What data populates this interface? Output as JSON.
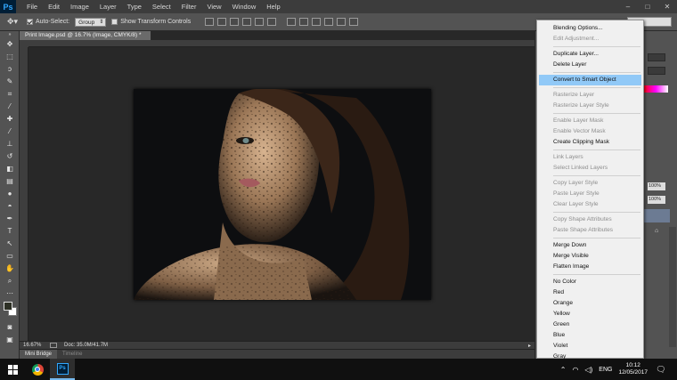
{
  "app": {
    "logo": "Ps"
  },
  "menubar": {
    "items": [
      "File",
      "Edit",
      "Image",
      "Layer",
      "Type",
      "Select",
      "Filter",
      "View",
      "Window",
      "Help"
    ],
    "window_controls": [
      "–",
      "□",
      "✕"
    ]
  },
  "options_bar": {
    "auto_select_label": "Auto-Select:",
    "auto_select_checked": true,
    "auto_select_value": "Group",
    "transform_label": "Show Transform Controls",
    "transform_checked": false
  },
  "document": {
    "tab_title": "Print Image.psd @ 16.7% (Image, CMYK/8) *",
    "zoom": "16.67%",
    "doc_size": "Doc: 35.0M/41.7M"
  },
  "bottom_tabs": [
    "Mini Bridge",
    "Timeline"
  ],
  "right_panel": {
    "opacity_value": "100%",
    "fill_value": "100%"
  },
  "context_menu": {
    "groups": [
      [
        {
          "label": "Blending Options...",
          "enabled": true
        },
        {
          "label": "Edit Adjustment...",
          "enabled": false
        }
      ],
      [
        {
          "label": "Duplicate Layer...",
          "enabled": true
        },
        {
          "label": "Delete Layer",
          "enabled": true
        }
      ],
      [
        {
          "label": "Convert to Smart Object",
          "enabled": true,
          "highlighted": true
        }
      ],
      [
        {
          "label": "Rasterize Layer",
          "enabled": false
        },
        {
          "label": "Rasterize Layer Style",
          "enabled": false
        }
      ],
      [
        {
          "label": "Enable Layer Mask",
          "enabled": false
        },
        {
          "label": "Enable Vector Mask",
          "enabled": false
        },
        {
          "label": "Create Clipping Mask",
          "enabled": true
        }
      ],
      [
        {
          "label": "Link Layers",
          "enabled": false
        },
        {
          "label": "Select Linked Layers",
          "enabled": false
        }
      ],
      [
        {
          "label": "Copy Layer Style",
          "enabled": false
        },
        {
          "label": "Paste Layer Style",
          "enabled": false
        },
        {
          "label": "Clear Layer Style",
          "enabled": false
        }
      ],
      [
        {
          "label": "Copy Shape Attributes",
          "enabled": false
        },
        {
          "label": "Paste Shape Attributes",
          "enabled": false
        }
      ],
      [
        {
          "label": "Merge Down",
          "enabled": true
        },
        {
          "label": "Merge Visible",
          "enabled": true
        },
        {
          "label": "Flatten Image",
          "enabled": true
        }
      ],
      [
        {
          "label": "No Color",
          "enabled": true
        },
        {
          "label": "Red",
          "enabled": true
        },
        {
          "label": "Orange",
          "enabled": true
        },
        {
          "label": "Yellow",
          "enabled": true
        },
        {
          "label": "Green",
          "enabled": true
        },
        {
          "label": "Blue",
          "enabled": true
        },
        {
          "label": "Violet",
          "enabled": true
        },
        {
          "label": "Gray",
          "enabled": true
        }
      ]
    ]
  },
  "taskbar": {
    "language": "ENG",
    "time": "10:12",
    "date": "12/05/2017"
  },
  "colors": {
    "highlight": "#91c9f7",
    "foreground_swatch": "#2d3025",
    "background_swatch": "#ffffff"
  }
}
